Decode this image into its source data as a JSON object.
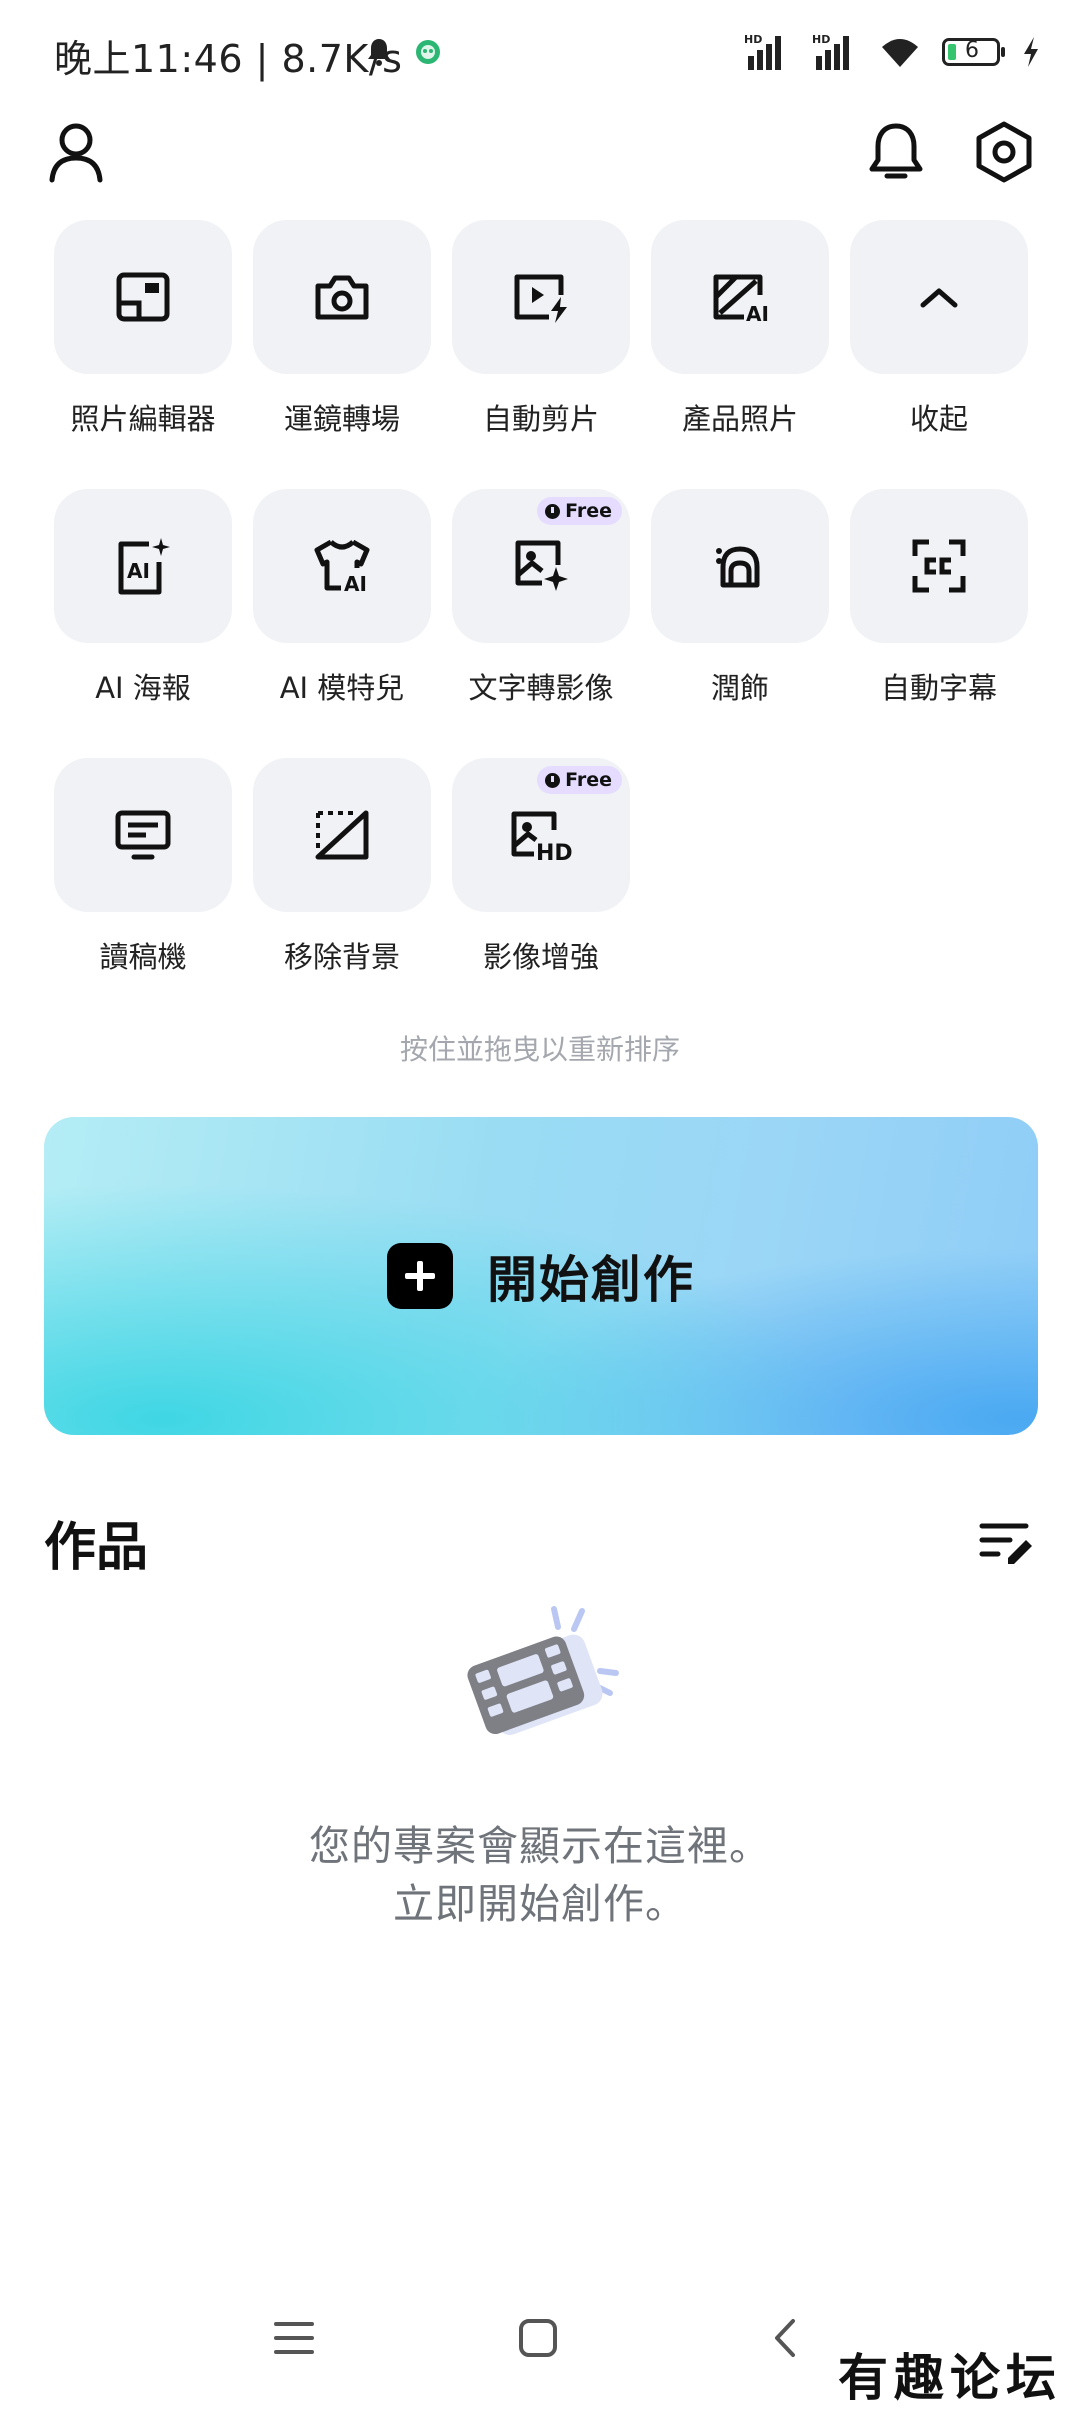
{
  "status_bar": {
    "time": "晚上11:46 | 8.7K/s",
    "battery": "6"
  },
  "header": {
    "profile_icon": "person-icon",
    "notification_icon": "bell-icon",
    "settings_icon": "hexagon-gear-icon"
  },
  "tools": [
    {
      "label": "照片編輯器",
      "icon": "photo-editor-icon",
      "free": false
    },
    {
      "label": "運鏡轉場",
      "icon": "camera-icon",
      "free": false
    },
    {
      "label": "自動剪片",
      "icon": "auto-cut-icon",
      "free": false
    },
    {
      "label": "產品照片",
      "icon": "product-photo-ai-icon",
      "free": false
    },
    {
      "label": "收起",
      "icon": "chevron-up-icon",
      "free": false
    },
    {
      "label": "AI 海報",
      "icon": "ai-poster-icon",
      "free": false
    },
    {
      "label": "AI 模特兒",
      "icon": "ai-model-shirt-icon",
      "free": false
    },
    {
      "label": "文字轉影像",
      "icon": "text-to-image-icon",
      "free": true
    },
    {
      "label": "潤飾",
      "icon": "retouch-icon",
      "free": false
    },
    {
      "label": "自動字幕",
      "icon": "captions-icon",
      "free": false
    },
    {
      "label": "讀稿機",
      "icon": "teleprompter-icon",
      "free": false
    },
    {
      "label": "移除背景",
      "icon": "remove-background-icon",
      "free": false
    },
    {
      "label": "影像增強",
      "icon": "image-enhance-hd-icon",
      "free": true
    }
  ],
  "free_badge": "Free",
  "reorder_hint": "按住並拖曳以重新排序",
  "create_button": {
    "label": "開始創作"
  },
  "works": {
    "title": "作品",
    "empty_line1": "您的專案會顯示在這裡。",
    "empty_line2": "立即開始創作。"
  },
  "watermark": "有趣论坛"
}
